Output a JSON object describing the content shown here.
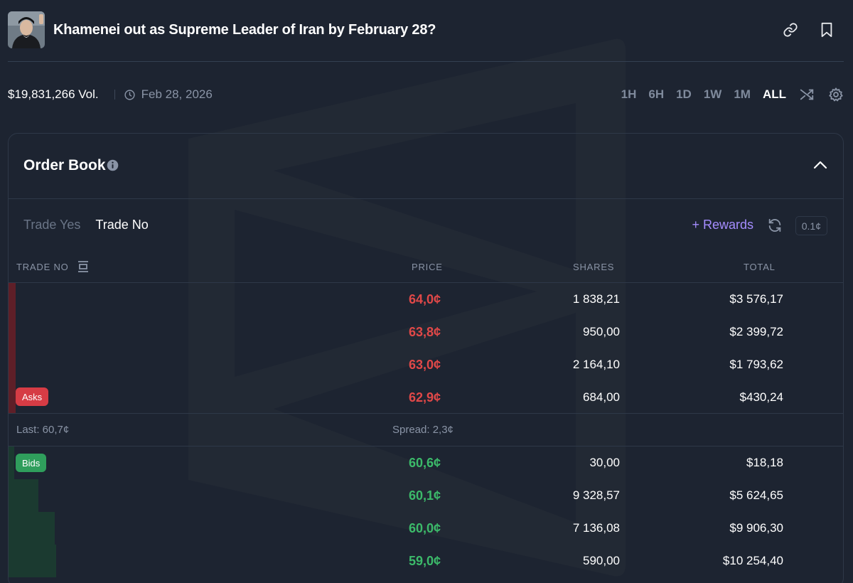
{
  "header": {
    "title": "Khamenei out as Supreme Leader of Iran by February 28?",
    "avatar_icon": "portrait-avatar"
  },
  "meta": {
    "volume": "$19,831,266 Vol.",
    "end_date": "Feb 28, 2026"
  },
  "time_ranges": [
    {
      "label": "1H",
      "active": false
    },
    {
      "label": "6H",
      "active": false
    },
    {
      "label": "1D",
      "active": false
    },
    {
      "label": "1W",
      "active": false
    },
    {
      "label": "1M",
      "active": false
    },
    {
      "label": "ALL",
      "active": true
    }
  ],
  "order_book": {
    "title": "Order Book",
    "tabs": [
      {
        "label": "Trade Yes",
        "active": false
      },
      {
        "label": "Trade No",
        "active": true
      }
    ],
    "rewards_label": "Rewards",
    "tick_size": "0.1¢",
    "columns": {
      "side": "TRADE NO",
      "price": "PRICE",
      "shares": "SHARES",
      "total": "TOTAL"
    },
    "asks_label": "Asks",
    "bids_label": "Bids",
    "asks": [
      {
        "price": "64,0¢",
        "shares": "1 838,21",
        "total": "$3 576,17"
      },
      {
        "price": "63,8¢",
        "shares": "950,00",
        "total": "$2 399,72"
      },
      {
        "price": "63,0¢",
        "shares": "2 164,10",
        "total": "$1 793,62"
      },
      {
        "price": "62,9¢",
        "shares": "684,00",
        "total": "$430,24"
      }
    ],
    "last": "Last: 60,7¢",
    "spread": "Spread: 2,3¢",
    "bids": [
      {
        "price": "60,6¢",
        "shares": "30,00",
        "total": "$18,18"
      },
      {
        "price": "60,1¢",
        "shares": "9 328,57",
        "total": "$5 624,65"
      },
      {
        "price": "60,0¢",
        "shares": "7 136,08",
        "total": "$9 906,30"
      },
      {
        "price": "59,0¢",
        "shares": "590,00",
        "total": "$10 254,40"
      }
    ]
  },
  "colors": {
    "background": "#1d2431",
    "ask": "#e04848",
    "bid": "#3cba6a",
    "rewards": "#a58dff"
  }
}
